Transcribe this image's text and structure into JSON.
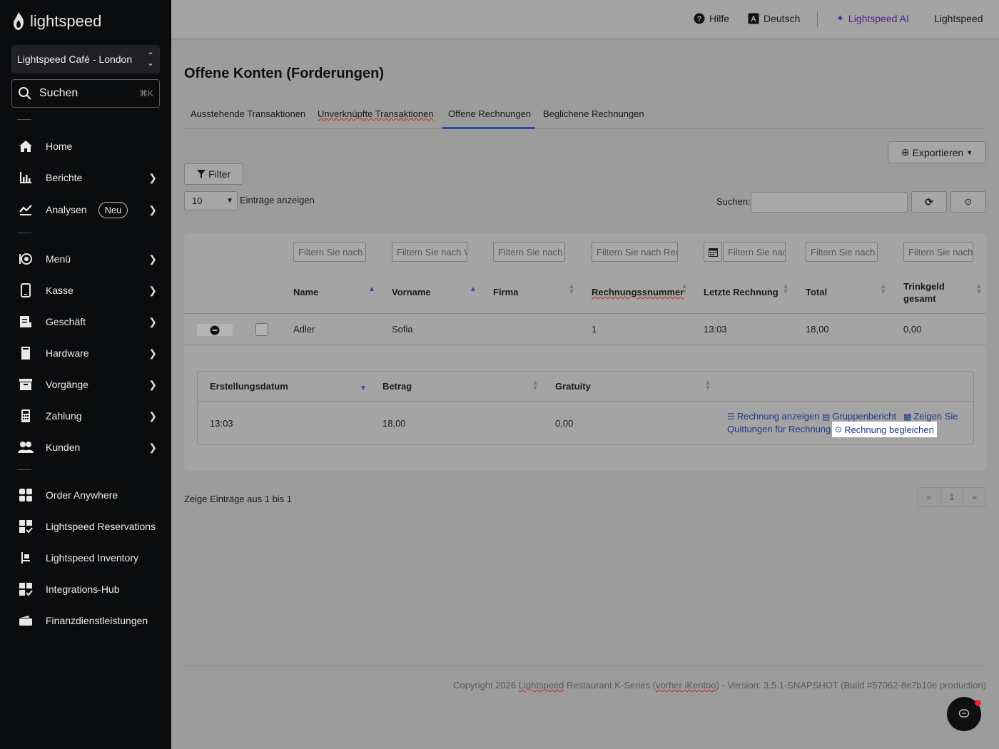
{
  "brand": {
    "logo_text": "lightspeed"
  },
  "sidebar": {
    "store_name": "Lightspeed Café - London",
    "search": {
      "label": "Suchen",
      "shortcut": "⌘K"
    },
    "items": [
      {
        "label": "Home"
      },
      {
        "label": "Berichte"
      },
      {
        "label": "Analysen",
        "badge": "Neu"
      },
      {
        "label": "Menü"
      },
      {
        "label": "Kasse"
      },
      {
        "label": "Geschäft"
      },
      {
        "label": "Hardware"
      },
      {
        "label": "Vorgänge"
      },
      {
        "label": "Zahlung"
      },
      {
        "label": "Kunden"
      },
      {
        "label": "Order Anywhere"
      },
      {
        "label": "Lightspeed Reservations"
      },
      {
        "label": "Lightspeed Inventory"
      },
      {
        "label": "Integrations-Hub"
      },
      {
        "label": "Finanzdienstleistungen"
      }
    ]
  },
  "topbar": {
    "help": "Hilfe",
    "language": "Deutsch",
    "ai": "Lightspeed AI",
    "account": "Lightspeed"
  },
  "page": {
    "title": "Offene Konten (Forderungen)",
    "tabs": [
      {
        "label": "Ausstehende Transaktionen"
      },
      {
        "label": "Unverknüpfte Transaktionen"
      },
      {
        "label": "Offene Rechnungen"
      },
      {
        "label": "Beglichene Rechnungen"
      }
    ],
    "active_tab": "Offene Rechnungen",
    "export_label": "Exportieren",
    "filter_label": "Filter",
    "page_length": "10",
    "entries_label": "Einträge anzeigen",
    "search_label": "Suchen:",
    "search_value": ""
  },
  "table": {
    "filter_placeholders": [
      "Filtern Sie nach Name",
      "Filtern Sie nach Vorname",
      "Filtern Sie nach Firma",
      "Filtern Sie nach Rechnungsnummer",
      "Filtern Sie nach Letzte Rechnung",
      "Filtern Sie nach Total",
      "Filtern Sie nach Trinkgeld gesamt"
    ],
    "columns": [
      "Name",
      "Vorname",
      "Firma",
      "Rechnungssnummer",
      "Letzte Rechnung",
      "Total",
      "Trinkgeld gesamt"
    ],
    "rows": [
      {
        "name": "Adler",
        "vorname": "Sofia",
        "firma": "",
        "nummer": "1",
        "letzte": "13:03",
        "total": "18,00",
        "trinkgeld": "0,00"
      }
    ]
  },
  "subtable": {
    "columns": [
      "Erstellungsdatum",
      "Betrag",
      "Gratuity"
    ],
    "rows": [
      {
        "datum": "13:03",
        "betrag": "18,00",
        "gratuity": "0,00"
      }
    ],
    "actions": {
      "show_invoice": "Rechnung anzeigen",
      "group_report": "Gruppenbericht",
      "show_receipts_1": "Zeigen Sie",
      "show_receipts_2": "Quittungen für Rechnung",
      "settle": "Rechnung begleichen"
    }
  },
  "pagination": {
    "info": "Zeige Einträge aus 1 bis 1",
    "prev": "«",
    "current": "1",
    "next": "»"
  },
  "footer": {
    "prefix": "Copyright 2026 ",
    "link1": "Lightspeed",
    "middle": " Restaurant K-Series (",
    "link2": "vorher iKentoo",
    "suffix": ") - Version: 3.5.1-SNAPSHOT (Build #57062-8e7b10e production)"
  }
}
